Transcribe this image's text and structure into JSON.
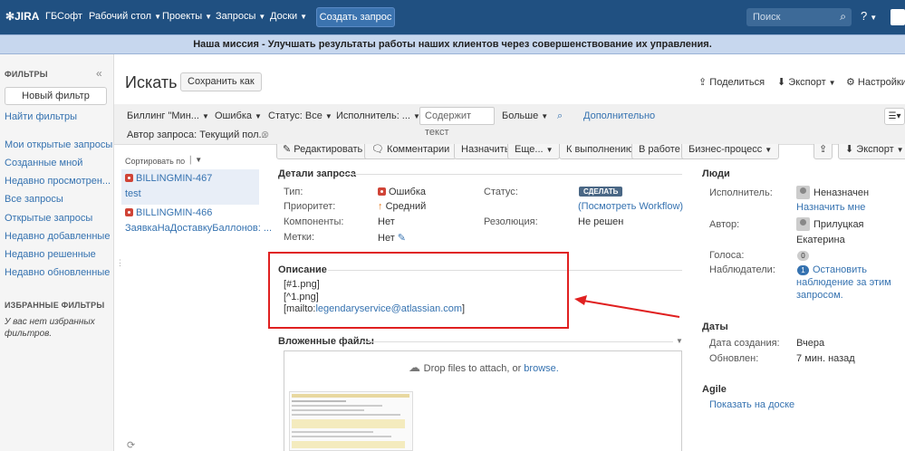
{
  "topnav": {
    "logo": "JIRA",
    "company": "ГБСофт",
    "items": [
      "Рабочий стол",
      "Проекты",
      "Запросы",
      "Доски"
    ],
    "create_label": "Создать запрос",
    "search_placeholder": "Поиск",
    "help": "?"
  },
  "banner": "Наша миссия - Улучшать результаты работы наших клиентов через совершенствование их управления.",
  "sidebar": {
    "header": "ФИЛЬТРЫ",
    "collapse": "«",
    "new_filter": "Новый фильтр",
    "find_filters": "Найти фильтры",
    "items": [
      "Мои открытые запросы",
      "Созданные мной",
      "Недавно просмотрен...",
      "Все запросы",
      "Открытые запросы",
      "Недавно добавленные",
      "Недавно решенные",
      "Недавно обновленные"
    ],
    "favorites_header": "ИЗБРАННЫЕ ФИЛЬТРЫ",
    "favorites_empty": "У вас нет избранных фильтров."
  },
  "header": {
    "title": "Искать",
    "save_as": "Сохранить как",
    "share": "Поделиться",
    "export": "Экспорт",
    "settings": "Настройки"
  },
  "filters": {
    "billing": "Биллинг \"Мин...",
    "type": "Ошибка",
    "status": "Статус: Все",
    "assignee": "Исполнитель: ...",
    "text_placeholder": "Содержит текст",
    "more": "Больше",
    "advanced": "Дополнительно",
    "author": "Автор запроса: Текущий пол..."
  },
  "results": {
    "sort_label": "Сортировать по",
    "issues": [
      {
        "key": "BILLINGMIN-467",
        "summary": "test"
      },
      {
        "key": "BILLINGMIN-466",
        "summary": "ЗаявкаНаДоставкуБаллонов: ..."
      }
    ]
  },
  "toolbar": {
    "edit": "Редактировать",
    "comment": "Комментарии",
    "assign": "Назначить",
    "more": "Еще...",
    "todo": "К выполнению",
    "in_progress": "В работе",
    "business": "Бизнес-процесс",
    "export": "Экспорт"
  },
  "details": {
    "header": "Детали запроса",
    "type_label": "Тип:",
    "type_value": "Ошибка",
    "priority_label": "Приоритет:",
    "priority_value": "Средний",
    "components_label": "Компоненты:",
    "components_value": "Нет",
    "labels_label": "Метки:",
    "labels_value": "Нет",
    "status_label": "Статус:",
    "status_value": "СДЕЛАТЬ",
    "workflow_link": "(Посмотреть Workflow)",
    "resolution_label": "Резолюция:",
    "resolution_value": "Не решен"
  },
  "description": {
    "header": "Описание",
    "lines": [
      "[#1.png]",
      "[^1.png]"
    ],
    "mailto_prefix": "[mailto:",
    "mailto_link": "legendaryservice@atlassian.com",
    "mailto_suffix": "]"
  },
  "attachments": {
    "header": "Вложенные файлы",
    "drop_text": "Drop files to attach, or",
    "browse": "browse."
  },
  "people": {
    "header": "Люди",
    "assignee_label": "Исполнитель:",
    "assignee_value": "Неназначен",
    "assign_me": "Назначить мне",
    "author_label": "Автор:",
    "author_value_1": "Прилуцкая",
    "author_value_2": "Екатерина",
    "votes_label": "Голоса:",
    "votes_value": "0",
    "watchers_label": "Наблюдатели:",
    "watchers_value": "1",
    "watch_stop_1": "Остановить",
    "watch_stop_2": "наблюдение за этим",
    "watch_stop_3": "запросом."
  },
  "dates": {
    "header": "Даты",
    "created_label": "Дата создания:",
    "created_value": "Вчера",
    "updated_label": "Обновлен:",
    "updated_value": "7 мин. назад"
  },
  "agile": {
    "header": "Agile",
    "show_board": "Показать на доске"
  }
}
